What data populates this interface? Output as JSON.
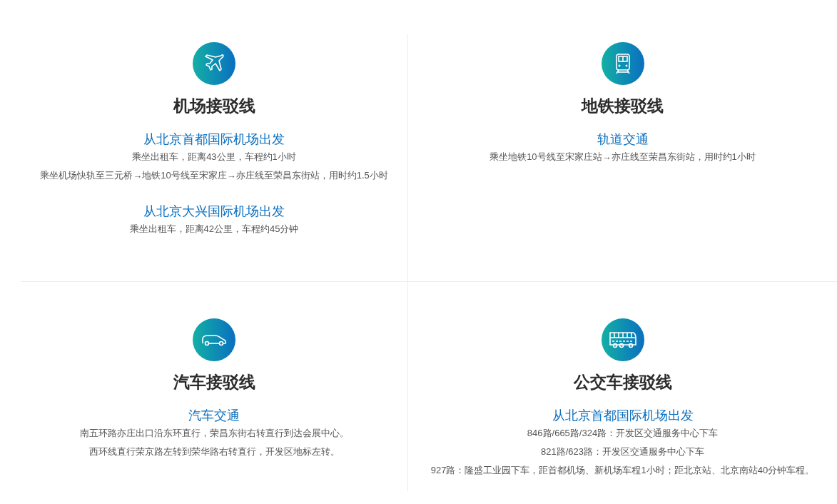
{
  "sections": [
    {
      "kind": "plane",
      "title": "机场接驳线",
      "groups": [
        {
          "heading": "从北京首都国际机场出发",
          "lines": [
            "乘坐出租车，距离43公里，车程约1小时",
            "乘坐机场快轨至三元桥→地铁10号线至宋家庄→亦庄线至荣昌东街站，用时约1.5小时"
          ]
        },
        {
          "heading": "从北京大兴国际机场出发",
          "lines": [
            "乘坐出租车，距离42公里，车程约45分钟"
          ]
        }
      ]
    },
    {
      "kind": "train",
      "title": "地铁接驳线",
      "groups": [
        {
          "heading": "轨道交通",
          "lines": [
            "乘坐地铁10号线至宋家庄站→亦庄线至荣昌东街站，用时约1小时"
          ]
        }
      ]
    },
    {
      "kind": "car",
      "title": "汽车接驳线",
      "groups": [
        {
          "heading": "汽车交通",
          "lines": [
            "南五环路亦庄出口沿东环直行，荣昌东街右转直行到达会展中心。",
            "西环线直行荣京路左转到荣华路右转直行，开发区地标左转。"
          ]
        }
      ]
    },
    {
      "kind": "bus",
      "title": "公交车接驳线",
      "groups": [
        {
          "heading": "从北京首都国际机场出发",
          "lines": [
            "846路/665路/324路：开发区交通服务中心下车",
            "821路/623路：开发区交通服务中心下车",
            "927路：隆盛工业园下车，距首都机场、新机场车程1小时；距北京站、北京南站40分钟车程。"
          ]
        }
      ]
    }
  ]
}
